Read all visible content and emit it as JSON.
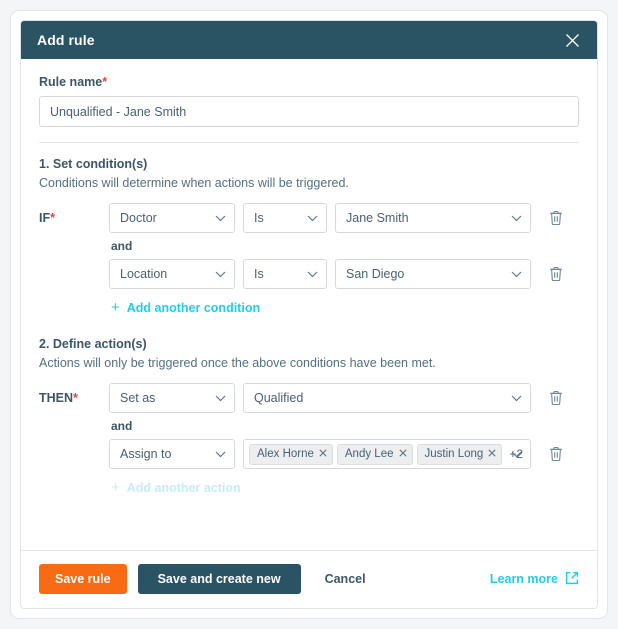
{
  "dialog": {
    "title": "Add rule",
    "close_icon": "close-icon"
  },
  "rule_name": {
    "label": "Rule name",
    "required_marker": "*",
    "value": "Unqualified - Jane Smith",
    "placeholder": "Rule name"
  },
  "conditions_section": {
    "title": "1. Set condition(s)",
    "description": "Conditions will determine when actions will be triggered.",
    "keyword": "IF",
    "required_marker": "*",
    "and_label": "and",
    "add_link": "Add another condition",
    "add_icon": "plus-icon",
    "delete_icon": "trash-icon",
    "rows": [
      {
        "field": "Doctor",
        "operator": "Is",
        "value": "Jane Smith"
      },
      {
        "field": "Location",
        "operator": "Is",
        "value": "San Diego"
      }
    ]
  },
  "actions_section": {
    "title": "2. Define action(s)",
    "description": "Actions will only be triggered once the above conditions have been met.",
    "keyword": "THEN",
    "required_marker": "*",
    "and_label": "and",
    "add_link": "Add another action",
    "add_icon": "plus-icon",
    "delete_icon": "trash-icon",
    "row_set_as": {
      "action": "Set as",
      "value": "Qualified"
    },
    "row_assign_to": {
      "action": "Assign to",
      "chips": [
        {
          "label": "Alex Horne",
          "remove_icon": "close-icon"
        },
        {
          "label": "Andy Lee",
          "remove_icon": "close-icon"
        },
        {
          "label": "Justin Long",
          "remove_icon": "close-icon"
        }
      ],
      "overflow_count": "+2"
    }
  },
  "footer": {
    "save_label": "Save rule",
    "save_create_label": "Save and create new",
    "cancel_label": "Cancel",
    "learn_more_label": "Learn more",
    "learn_more_icon": "external-link-icon"
  },
  "colors": {
    "header_teal": "#2a5364",
    "accent_orange": "#f96b12",
    "accent_cyan": "#22cdeb",
    "required_red": "#e8413a",
    "text_slate": "#3c5665"
  }
}
